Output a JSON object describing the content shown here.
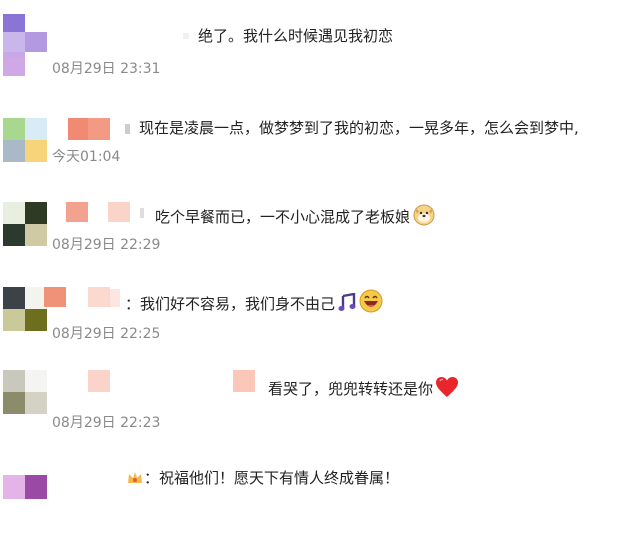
{
  "comments": [
    {
      "text": "绝了。我什么时候遇见我初恋",
      "time": "08月29日 23:31"
    },
    {
      "text": "现在是凌晨一点，做梦梦到了我的初恋，一晃多年，怎么会到梦中,",
      "time": "今天01:04"
    },
    {
      "text": "吃个早餐而已，一不小心混成了老板娘",
      "time": "08月29日 22:29",
      "emoji": "doge-face-icon"
    },
    {
      "text": "我们好不容易，我们身不由己",
      "time": "08月29日 22:25",
      "emoji": [
        "music-notes-icon",
        "laughing-face-icon"
      ]
    },
    {
      "text": "看哭了，兜兜转转还是你",
      "time": "08月29日 22:23",
      "emoji": "red-heart-icon"
    },
    {
      "text": "祝福他们！愿天下有情人终成眷属！",
      "time": ""
    }
  ],
  "colors": {
    "text": "#222222",
    "time": "#8a8a8a",
    "heart": "#e8262b"
  }
}
